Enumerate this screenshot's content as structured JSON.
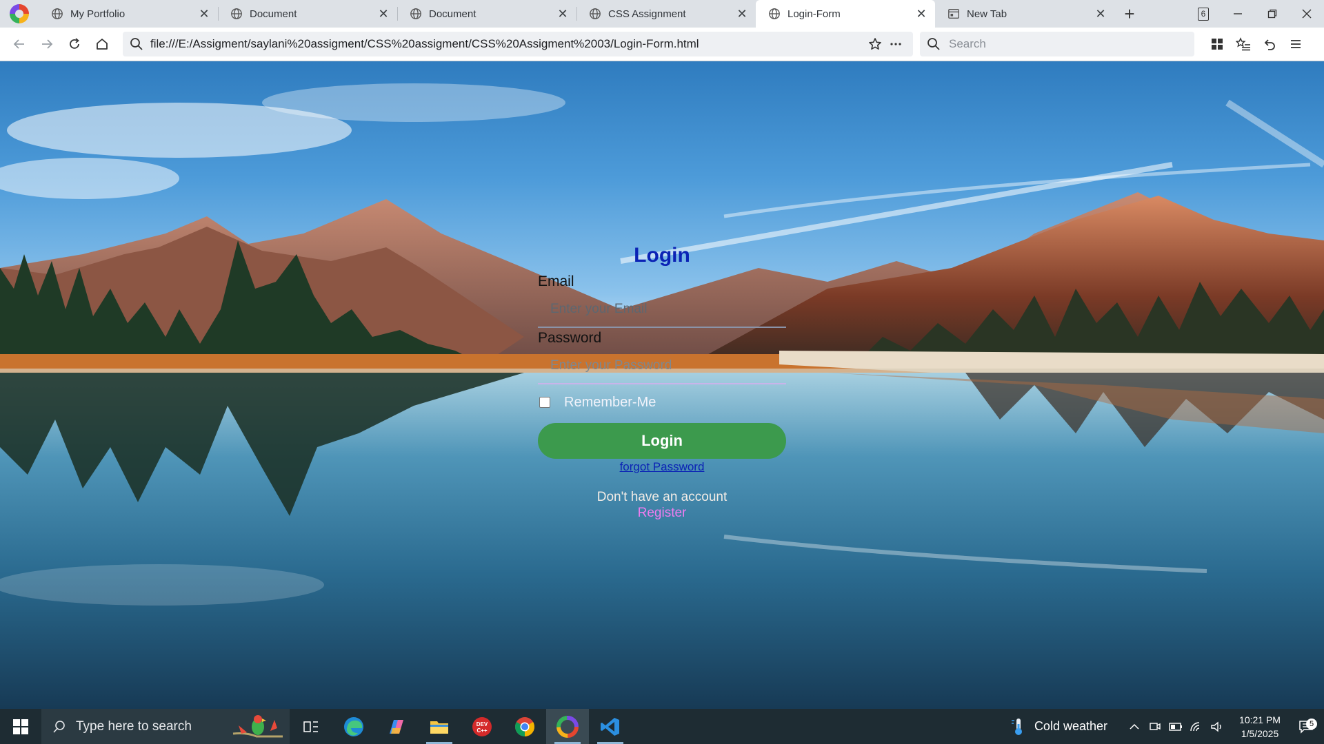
{
  "browser": {
    "tabs": [
      {
        "title": "My Portfolio",
        "icon": "globe-icon",
        "active": false
      },
      {
        "title": "Document",
        "icon": "globe-icon",
        "active": false
      },
      {
        "title": "Document",
        "icon": "globe-icon",
        "active": false
      },
      {
        "title": "CSS Assignment",
        "icon": "globe-icon",
        "active": false
      },
      {
        "title": "Login-Form",
        "icon": "globe-icon",
        "active": true
      },
      {
        "title": "New Tab",
        "icon": "newtab-page-icon",
        "active": false
      }
    ],
    "tab_count": "6",
    "url": "file:///E:/Assigment/saylani%20assigment/CSS%20assigment/CSS%20Assigment%2003/Login-Form.html",
    "search_placeholder": "Search"
  },
  "login": {
    "title": "Login",
    "email_label": "Email",
    "email_placeholder": "Enter your Email",
    "password_label": "Password",
    "password_placeholder": "Enter your Password",
    "remember_label": "Remember-Me",
    "remember_checked": false,
    "login_button": "Login",
    "forgot_link": "forgot Password",
    "no_account_text": "Don't have an account",
    "register_link": "Register"
  },
  "taskbar": {
    "search_text": "Type here to search",
    "weather": "Cold weather",
    "time": "10:21 PM",
    "date": "1/5/2025",
    "notifications": "5"
  },
  "colors": {
    "login_title": "#0b23b5",
    "login_button": "#3c9a4d",
    "register_link": "#f07cf0",
    "taskbar": "#1e2c33"
  }
}
